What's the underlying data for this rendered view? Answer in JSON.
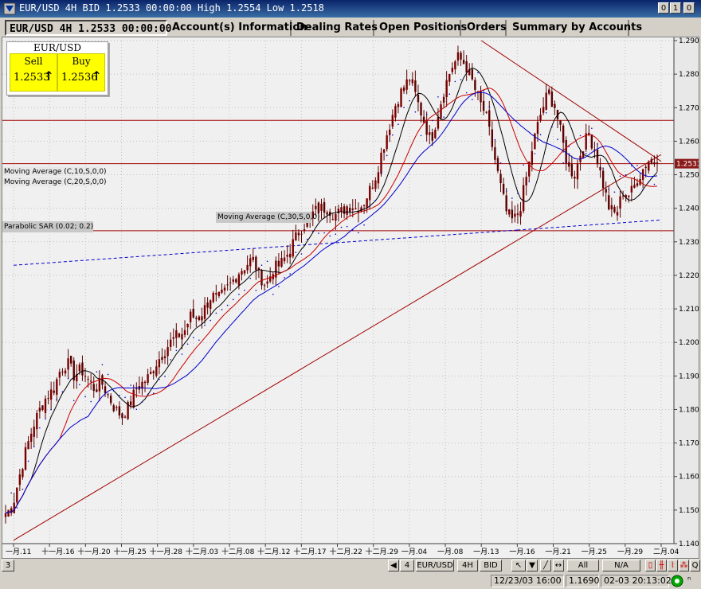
{
  "window": {
    "title": "EUR/USD 4H BID 1.2533 00:00:00 High 1.2554 Low 1.2518",
    "buttons": [
      "0",
      "1",
      "0"
    ]
  },
  "tabs": [
    {
      "label": "EUR/USD 4H 1.2533 00:00:00",
      "active": true
    },
    {
      "label": "Account(s) Information"
    },
    {
      "label": "Dealing Rates"
    },
    {
      "label": "Open Positions"
    },
    {
      "label": "Orders"
    },
    {
      "label": "Summary by Accounts"
    }
  ],
  "quote": {
    "symbol": "EUR/USD",
    "sell_label": "Sell",
    "buy_label": "Buy",
    "sell_value": "1.2533",
    "buy_value": "1.2536",
    "sell_arrow": "↑",
    "buy_arrow": "↑"
  },
  "indicators": {
    "ma10": "Moving Average (C,10,S,0,0)",
    "ma20": "Moving Average (C,20,S,0,0)",
    "ma30": "Moving Average (C,30,S,0,0)",
    "sar": "Parabolic SAR (0.02; 0.2)"
  },
  "bottom": {
    "page": "3",
    "count": "4",
    "symbol": "EUR/USD",
    "period": "4H",
    "price_type": "BID",
    "range": "All",
    "na": "N/A",
    "q": "Q"
  },
  "status": {
    "cursor_time": "12/23/03 16:00",
    "cursor_price": "1.1690",
    "clock": "02-03  20:13:02",
    "extra": "ⁿ"
  },
  "chart_data": {
    "type": "candlestick",
    "symbol": "EUR/USD",
    "timeframe": "4H",
    "current_price": 1.2533,
    "ylim": [
      1.14,
      1.29
    ],
    "yticks": [
      1.29,
      1.28,
      1.27,
      1.26,
      1.25,
      1.24,
      1.23,
      1.22,
      1.21,
      1.2,
      1.19,
      1.18,
      1.17,
      1.16,
      1.15,
      1.14
    ],
    "xticks": [
      "一月.11",
      "十一月.16",
      "十一月.20",
      "十一月.25",
      "十一月.28",
      "十二月.03",
      "十二月.08",
      "十二月.12",
      "十二月.17",
      "十二月.22",
      "十二月.29",
      "一月.04",
      "一月.08",
      "一月.13",
      "一月.16",
      "一月.21",
      "一月.25",
      "一月.29",
      "二月.04"
    ],
    "close_path": [
      1.149,
      1.151,
      1.16,
      1.168,
      1.175,
      1.18,
      1.184,
      1.186,
      1.192,
      1.194,
      1.19,
      1.192,
      1.189,
      1.186,
      1.188,
      1.184,
      1.18,
      1.178,
      1.181,
      1.186,
      1.188,
      1.19,
      1.194,
      1.197,
      1.2,
      1.202,
      1.203,
      1.208,
      1.207,
      1.21,
      1.214,
      1.213,
      1.215,
      1.218,
      1.221,
      1.223,
      1.225,
      1.22,
      1.217,
      1.222,
      1.223,
      1.226,
      1.23,
      1.234,
      1.236,
      1.239,
      1.24,
      1.24,
      1.238,
      1.239,
      1.241,
      1.24,
      1.241,
      1.245,
      1.25,
      1.258,
      1.265,
      1.272,
      1.276,
      1.279,
      1.272,
      1.266,
      1.26,
      1.268,
      1.276,
      1.282,
      1.285,
      1.283,
      1.278,
      1.272,
      1.268,
      1.258,
      1.248,
      1.239,
      1.236,
      1.24,
      1.25,
      1.26,
      1.268,
      1.274,
      1.271,
      1.262,
      1.252,
      1.25,
      1.258,
      1.262,
      1.257,
      1.248,
      1.24,
      1.238,
      1.245,
      1.244,
      1.248,
      1.252,
      1.255,
      1.253
    ],
    "horizontal_levels": [
      1.2662,
      1.2533,
      1.2333
    ],
    "trendlines": [
      {
        "from": [
          "一月.11",
          1.141
        ],
        "to": [
          "二月.04",
          1.256
        ],
        "color": "#a00000"
      },
      {
        "from": [
          "一月.13",
          1.29
        ],
        "to": [
          "二月.04",
          1.254
        ],
        "color": "#a00000"
      },
      {
        "from": [
          "一月.16",
          1.2335
        ],
        "to": [
          "二月.04",
          1.2365
        ],
        "color": "#0000cc",
        "style": "dashed"
      },
      {
        "from": [
          "一月.11",
          1.223
        ],
        "to": [
          "一月.16",
          1.2335
        ],
        "color": "#0000cc",
        "style": "dashed"
      }
    ],
    "series": [
      {
        "name": "Moving Average (C,10,S,0,0)",
        "color": "#000000"
      },
      {
        "name": "Moving Average (C,20,S,0,0)",
        "color": "#cc0000"
      },
      {
        "name": "Moving Average (C,30,S,0,0)",
        "color": "#0000cc"
      },
      {
        "name": "Parabolic SAR (0.02; 0.2)",
        "color": "#0000cc",
        "style": "dots"
      }
    ]
  }
}
